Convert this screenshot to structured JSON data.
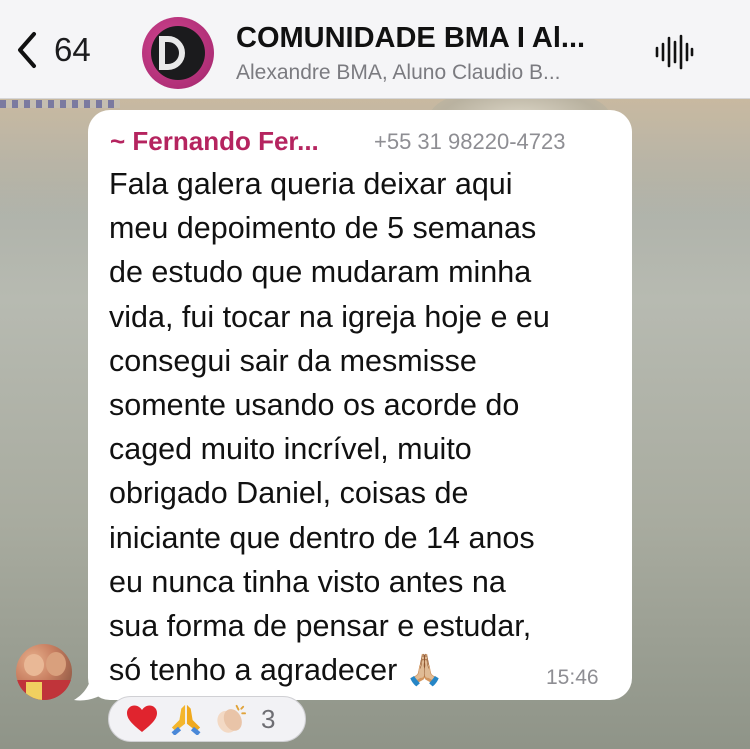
{
  "header": {
    "back_count": "64",
    "group_title": "COMUNIDADE BMA I Al...",
    "group_members": "Alexandre BMA, Aluno Claudio B..."
  },
  "message": {
    "sender_name": "~ Fernando Fer...",
    "sender_phone": "+55 31 98220-4723",
    "text": "Fala galera queria deixar aqui\nmeu depoimento de 5 semanas\nde estudo que mudaram minha\nvida, fui tocar na igreja hoje e eu\nconsegui sair da mesmisse\nsomente usando os acorde do\ncaged muito incrível, muito\nobrigado Daniel, coisas de\niniciante que dentro de 14 anos\neu nunca tinha visto antes na\nsua forma de pensar e estudar,\nsó tenho a agradecer 🙏🏼",
    "time": "15:46"
  },
  "reactions": {
    "emojis": [
      "heart",
      "praying-hands",
      "clapping-hands"
    ],
    "count": "3"
  },
  "colors": {
    "sender_name": "#b5245f",
    "group_avatar": "#c2397f"
  }
}
